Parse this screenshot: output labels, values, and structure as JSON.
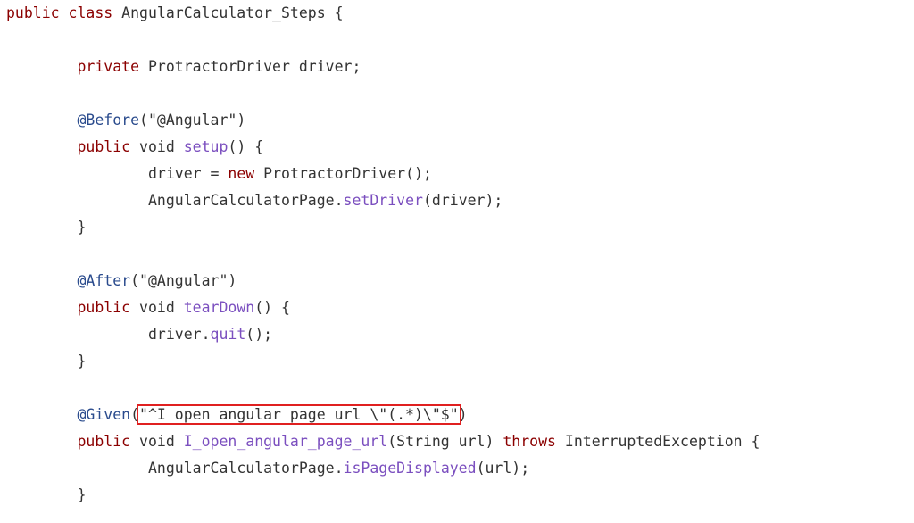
{
  "colors": {
    "keyword": "#8b0000",
    "annotation": "#2a4b8d",
    "method": "#7b4fbf",
    "plain": "#333333",
    "highlight_border": "#e02020"
  },
  "code": {
    "lines": [
      {
        "indent": 0,
        "tokens": [
          {
            "t": "public",
            "k": "keyword"
          },
          {
            "t": " ",
            "k": "plain"
          },
          {
            "t": "class",
            "k": "keyword"
          },
          {
            "t": " AngularCalculator_Steps {",
            "k": "plain"
          }
        ]
      },
      {
        "indent": 0,
        "tokens": []
      },
      {
        "indent": 1,
        "tokens": [
          {
            "t": "private",
            "k": "keyword"
          },
          {
            "t": " ProtractorDriver driver;",
            "k": "plain"
          }
        ]
      },
      {
        "indent": 0,
        "tokens": []
      },
      {
        "indent": 1,
        "tokens": [
          {
            "t": "@Before",
            "k": "annotation"
          },
          {
            "t": "(\"@Angular\")",
            "k": "plain"
          }
        ]
      },
      {
        "indent": 1,
        "tokens": [
          {
            "t": "public",
            "k": "keyword"
          },
          {
            "t": " void ",
            "k": "plain"
          },
          {
            "t": "setup",
            "k": "method"
          },
          {
            "t": "() {",
            "k": "plain"
          }
        ]
      },
      {
        "indent": 2,
        "tokens": [
          {
            "t": "driver = ",
            "k": "plain"
          },
          {
            "t": "new",
            "k": "keyword"
          },
          {
            "t": " ProtractorDriver();",
            "k": "plain"
          }
        ]
      },
      {
        "indent": 2,
        "tokens": [
          {
            "t": "AngularCalculatorPage.",
            "k": "plain"
          },
          {
            "t": "setDriver",
            "k": "method"
          },
          {
            "t": "(driver);",
            "k": "plain"
          }
        ]
      },
      {
        "indent": 1,
        "tokens": [
          {
            "t": "}",
            "k": "plain"
          }
        ]
      },
      {
        "indent": 0,
        "tokens": []
      },
      {
        "indent": 1,
        "tokens": [
          {
            "t": "@After",
            "k": "annotation"
          },
          {
            "t": "(\"@Angular\")",
            "k": "plain"
          }
        ]
      },
      {
        "indent": 1,
        "tokens": [
          {
            "t": "public",
            "k": "keyword"
          },
          {
            "t": " void ",
            "k": "plain"
          },
          {
            "t": "tearDown",
            "k": "method"
          },
          {
            "t": "() {",
            "k": "plain"
          }
        ]
      },
      {
        "indent": 2,
        "tokens": [
          {
            "t": "driver.",
            "k": "plain"
          },
          {
            "t": "quit",
            "k": "method"
          },
          {
            "t": "();",
            "k": "plain"
          }
        ]
      },
      {
        "indent": 1,
        "tokens": [
          {
            "t": "}",
            "k": "plain"
          }
        ]
      },
      {
        "indent": 0,
        "tokens": []
      },
      {
        "indent": 1,
        "tokens": [
          {
            "t": "@Given",
            "k": "annotation"
          },
          {
            "t": "(",
            "k": "plain"
          },
          {
            "t": "\"^I open angular page url \\\"(.*)\\\"$\"",
            "k": "string",
            "highlight": true
          },
          {
            "t": ")",
            "k": "plain"
          }
        ]
      },
      {
        "indent": 1,
        "tokens": [
          {
            "t": "public",
            "k": "keyword"
          },
          {
            "t": " void ",
            "k": "plain"
          },
          {
            "t": "I_open_angular_page_url",
            "k": "method"
          },
          {
            "t": "(String url) ",
            "k": "plain"
          },
          {
            "t": "throws",
            "k": "keyword-alt"
          },
          {
            "t": " InterruptedException {",
            "k": "plain"
          }
        ]
      },
      {
        "indent": 2,
        "tokens": [
          {
            "t": "AngularCalculatorPage.",
            "k": "plain"
          },
          {
            "t": "isPageDisplayed",
            "k": "method"
          },
          {
            "t": "(url);",
            "k": "plain"
          }
        ]
      },
      {
        "indent": 1,
        "tokens": [
          {
            "t": "}",
            "k": "plain"
          }
        ]
      }
    ]
  }
}
